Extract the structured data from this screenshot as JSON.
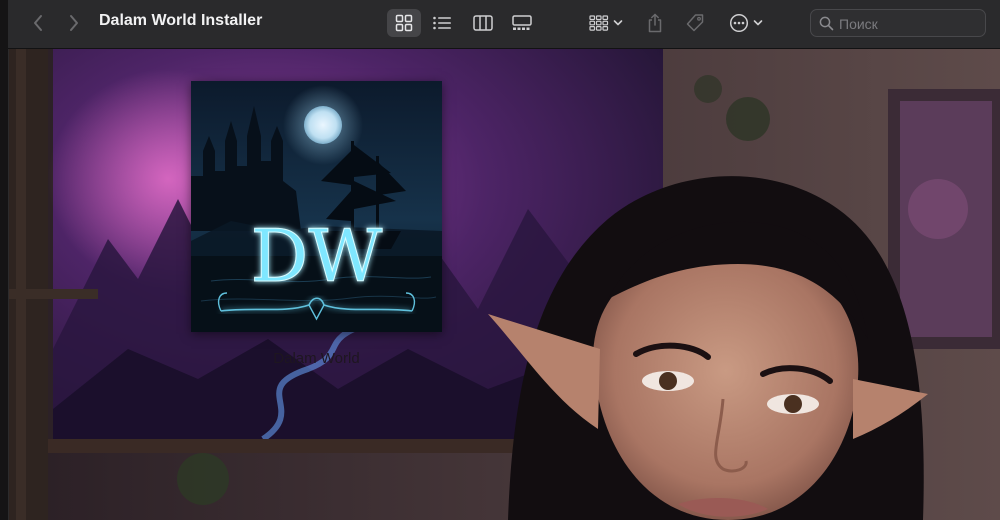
{
  "window": {
    "title": "Dalam World Installer"
  },
  "toolbar": {
    "back_icon": "chevron-left-icon",
    "forward_icon": "chevron-right-icon",
    "view_modes": [
      "icon-view-icon",
      "list-view-icon",
      "column-view-icon",
      "gallery-view-icon"
    ],
    "active_view": "icon-view",
    "group_icon": "group-grid-icon",
    "share_icon": "share-icon",
    "tag_icon": "tag-icon",
    "more_icon": "ellipsis-circle-icon",
    "search": {
      "placeholder": "Поиск",
      "value": ""
    }
  },
  "items": [
    {
      "label": "Dalam World",
      "icon_letters": "DW"
    }
  ],
  "colors": {
    "toolbar_bg": "#2a2a2c",
    "icon_glow": "#7fe7ff"
  }
}
